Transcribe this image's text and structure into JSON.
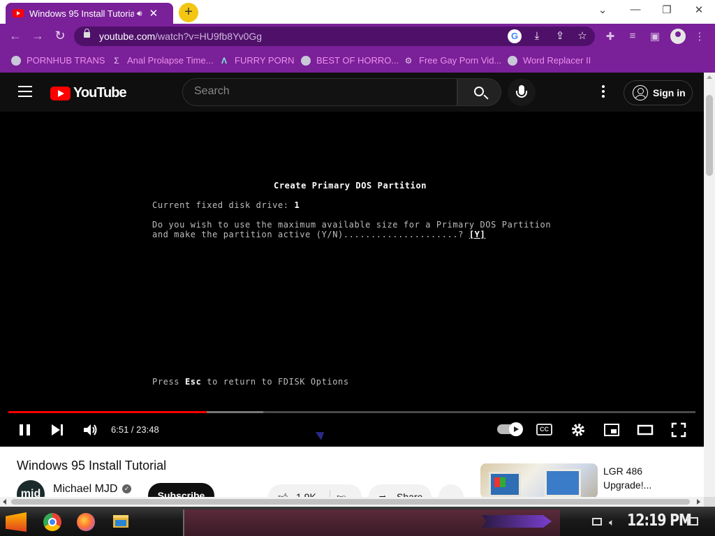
{
  "browser": {
    "tab": {
      "title": "Windows 95 Install Tutorial",
      "audio_icon": "speaker-icon",
      "close_label": "✕"
    },
    "new_tab_label": "+",
    "window_controls": [
      "⌄",
      "—",
      "❐",
      "✕"
    ],
    "nav": {
      "back": "←",
      "forward": "→",
      "reload": "↻"
    },
    "url_host": "youtube.com",
    "url_path": "/watch?v=HU9fb8Yv0Gg",
    "accent": "#7a2098",
    "bookmarks": [
      {
        "label": "PORNHUB TRANS",
        "icon": "globe-icon"
      },
      {
        "label": "Anal Prolapse Time...",
        "icon": "sigma-icon"
      },
      {
        "label": "FURRY PORN",
        "icon": "lambda-icon"
      },
      {
        "label": "BEST OF HORRO...",
        "icon": "globe-icon"
      },
      {
        "label": "Free Gay Porn Vid...",
        "icon": "gear-icon"
      },
      {
        "label": "Word Replacer II",
        "icon": "globe-icon"
      }
    ]
  },
  "youtube": {
    "logo_text": "YouTube",
    "search_placeholder": "Search",
    "sign_in_label": "Sign in"
  },
  "video_frame": {
    "heading": "Create Primary DOS Partition",
    "drive_line_label": "Current fixed disk drive: ",
    "drive_number": "1",
    "question_line1": "Do you wish to use the maximum available size for a Primary DOS Partition",
    "question_line2": "and make the partition active (Y/N).....................? ",
    "answer": "[Y]",
    "footer_prefix": "Press ",
    "footer_key": "Esc",
    "footer_suffix": " to return to FDISK Options"
  },
  "player": {
    "current_time": "6:51",
    "duration": "23:48",
    "time_display": "6:51 / 23:48",
    "progress_fraction": 0.289,
    "buffered_fraction": 0.371,
    "cc_label": "CC",
    "progress_color": "#ff0000"
  },
  "video_info": {
    "title": "Windows 95 Install Tutorial",
    "channel_name": "Michael MJD",
    "channel_avatar_text": "mjd",
    "subscribe_label": "Subscribe",
    "like_count": "1.9K",
    "share_label": "Share",
    "more_label": "..."
  },
  "recommendation": {
    "title": "LGR 486 Upgrade!..."
  },
  "taskbar": {
    "clock": "12:19 PM"
  }
}
